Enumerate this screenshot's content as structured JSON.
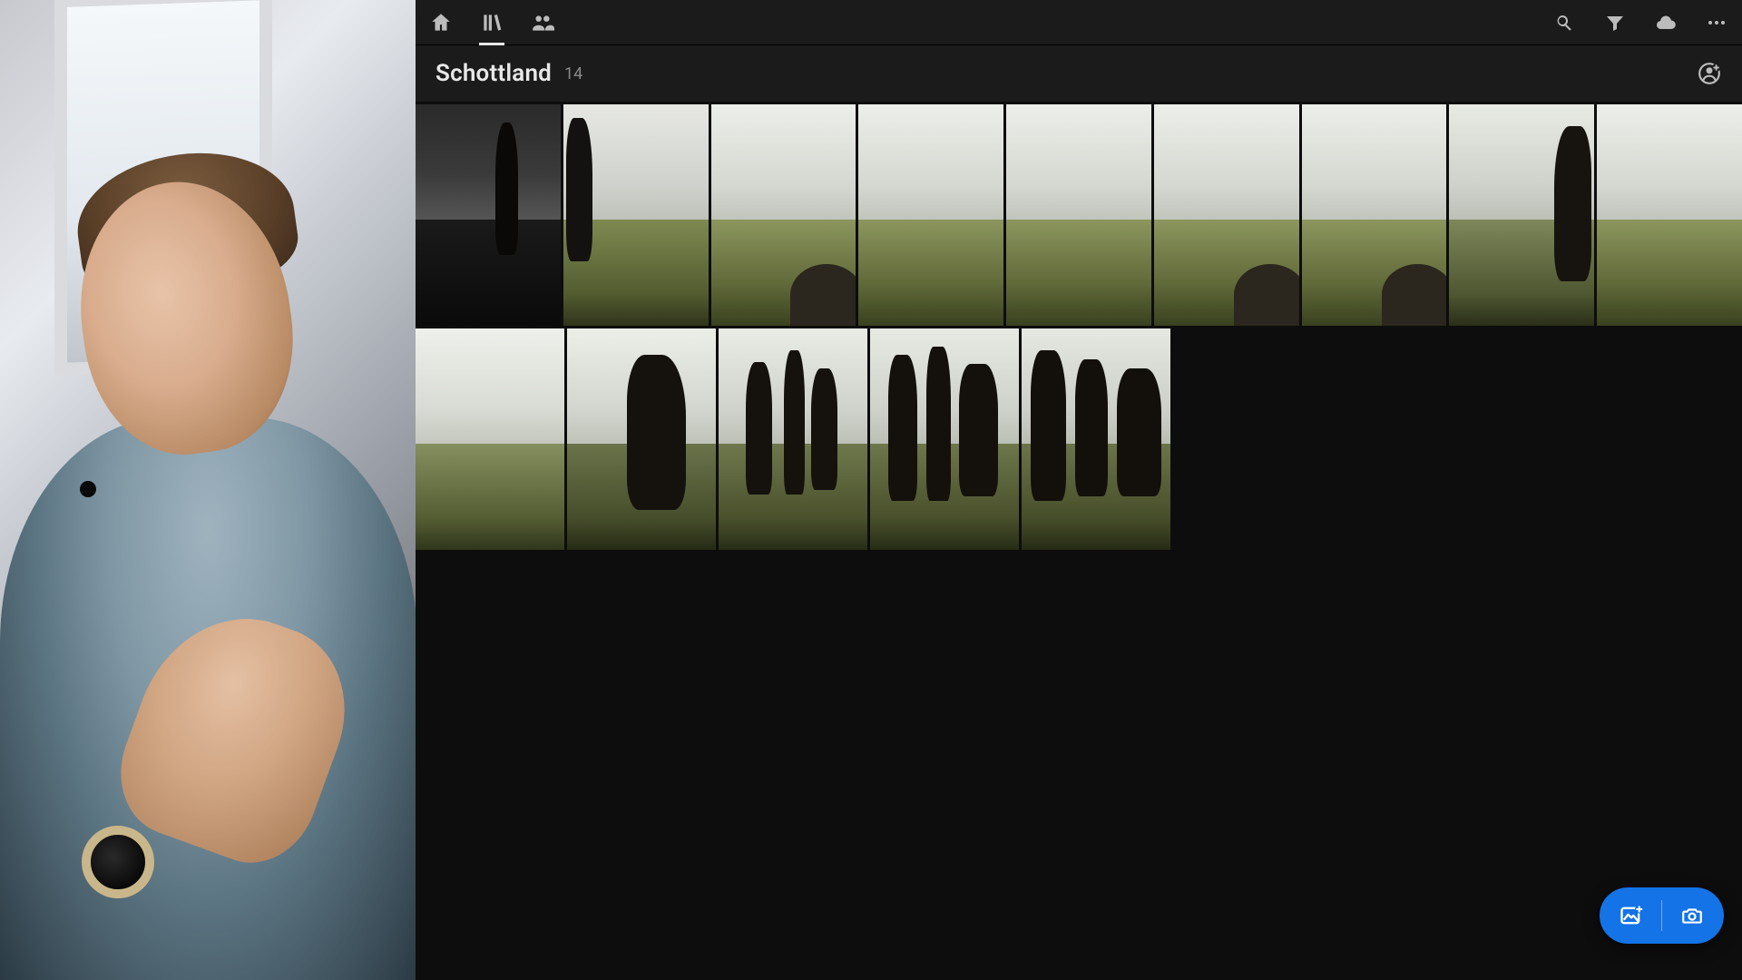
{
  "album": {
    "title": "Schottland",
    "count": "14"
  },
  "nav": {
    "home": "home-icon",
    "library": "library-icon",
    "people": "people-icon",
    "search": "search-icon",
    "filter": "filter-icon",
    "cloud": "cloud-icon",
    "more": "more-icon",
    "profile": "profile-icon"
  },
  "fab": {
    "add_photo": "add-photo-icon",
    "camera": "camera-icon"
  },
  "colors": {
    "accent": "#1473e6",
    "toolbar_bg": "#1b1b1b",
    "app_bg": "#0d0d0d",
    "text": "#e8e8e8",
    "text_muted": "#8a8a8a"
  },
  "thumbnails": {
    "row1_count": 9,
    "row2_count": 5
  }
}
